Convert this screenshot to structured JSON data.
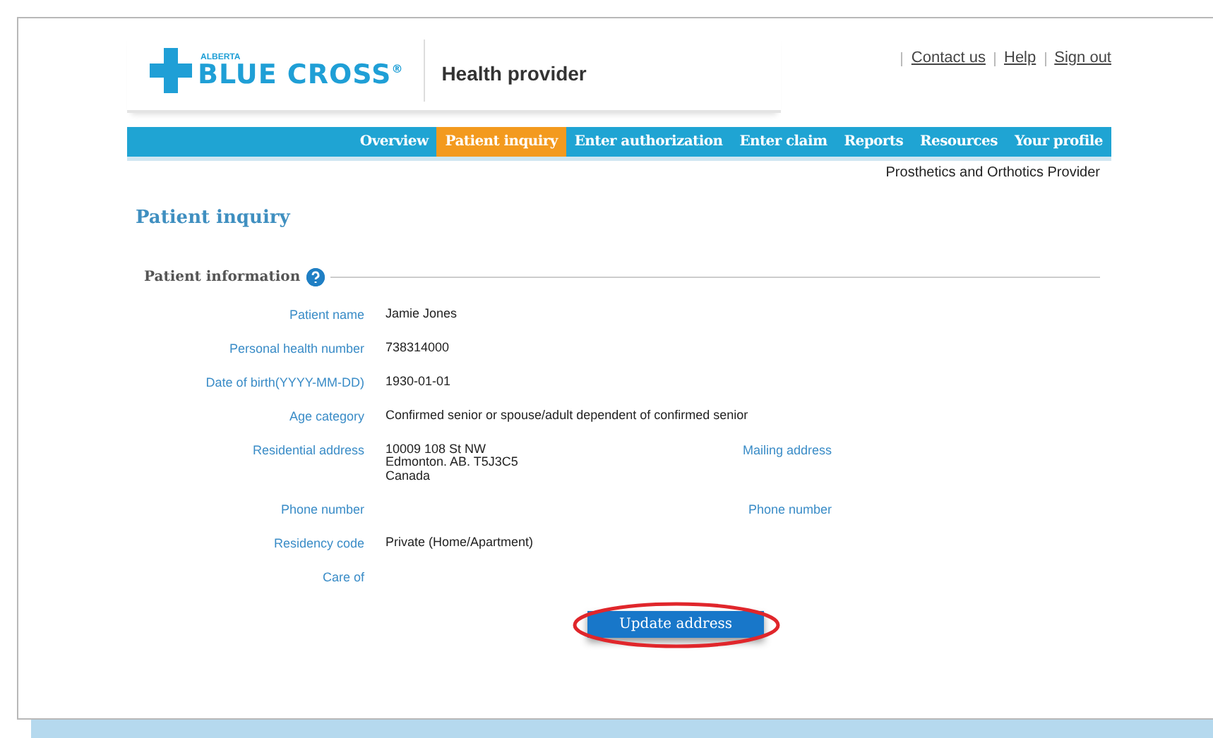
{
  "header": {
    "logo_small": "ALBERTA",
    "logo_text": "BLUE CROSS",
    "logo_mark": "®",
    "portal": "Health provider",
    "links": [
      "Contact us",
      "Help",
      "Sign out"
    ]
  },
  "nav": [
    {
      "label": "Overview",
      "selected": false
    },
    {
      "label": "Patient inquiry",
      "selected": true
    },
    {
      "label": "Enter authorization",
      "selected": false
    },
    {
      "label": "Enter claim",
      "selected": false
    },
    {
      "label": "Reports",
      "selected": false
    },
    {
      "label": "Resources",
      "selected": false
    },
    {
      "label": "Your profile",
      "selected": false
    }
  ],
  "provider_type": "Prosthetics and Orthotics Provider",
  "page_title": "Patient inquiry",
  "section": {
    "title": "Patient information"
  },
  "fields": [
    {
      "label": "Patient name",
      "value": [
        "Jamie Jones"
      ]
    },
    {
      "label": "Personal health number",
      "value": [
        "738314000"
      ]
    },
    {
      "label": "Date of birth(YYYY-MM-DD)",
      "value": [
        "1930-01-01"
      ]
    },
    {
      "label": "Age category",
      "value": [
        "Confirmed senior or spouse/adult dependent of confirmed senior"
      ]
    },
    {
      "label": "Residential address",
      "value": [
        "10009 108 St NW",
        "Edmonton. AB. T5J3C5",
        "Canada"
      ],
      "side_label": "Mailing address"
    },
    {
      "label": "Phone number",
      "side_label": "Phone number"
    },
    {
      "label": "Residency code",
      "value": [
        "Private (Home/Apartment)"
      ]
    },
    {
      "label": "Care of"
    }
  ],
  "button": {
    "label": "Update address",
    "highlighted": true
  }
}
